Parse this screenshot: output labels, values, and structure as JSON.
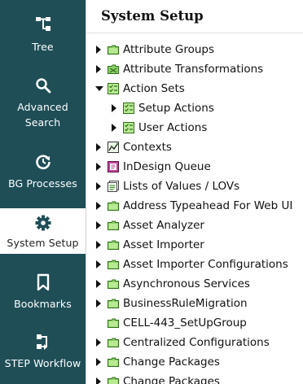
{
  "sidebar": {
    "items": [
      {
        "label": "Tree",
        "icon": "tree-icon",
        "active": false
      },
      {
        "label": "Advanced Search",
        "line1": "Advanced",
        "line2": "Search",
        "icon": "search-icon",
        "active": false
      },
      {
        "label": "BG Processes",
        "icon": "bg-processes-icon",
        "active": false
      },
      {
        "label": "System Setup",
        "icon": "gear-icon",
        "active": true
      },
      {
        "label": "Bookmarks",
        "icon": "bookmark-icon",
        "active": false
      },
      {
        "label": "STEP Workflow",
        "icon": "workflow-icon",
        "active": false
      }
    ]
  },
  "main": {
    "title": "System Setup",
    "tree": [
      {
        "label": "Attribute Groups",
        "icon": "folder-icon",
        "state": "collapsed",
        "level": 0
      },
      {
        "label": "Attribute Transformations",
        "icon": "transformation-folder-icon",
        "state": "collapsed",
        "level": 0
      },
      {
        "label": "Action Sets",
        "icon": "action-set-icon",
        "state": "expanded",
        "level": 0
      },
      {
        "label": "Setup Actions",
        "icon": "action-set-icon",
        "state": "collapsed",
        "level": 1
      },
      {
        "label": "User Actions",
        "icon": "action-set-icon",
        "state": "collapsed",
        "level": 1
      },
      {
        "label": "Contexts",
        "icon": "contexts-icon",
        "state": "collapsed",
        "level": 0
      },
      {
        "label": "InDesign Queue",
        "icon": "indesign-queue-icon",
        "state": "collapsed",
        "level": 0
      },
      {
        "label": "Lists of Values / LOVs",
        "icon": "lov-icon",
        "state": "collapsed",
        "level": 0
      },
      {
        "label": "Address Typeahead For Web UI",
        "icon": "folder-icon",
        "state": "collapsed",
        "level": 0
      },
      {
        "label": "Asset Analyzer",
        "icon": "folder-icon",
        "state": "collapsed",
        "level": 0
      },
      {
        "label": "Asset Importer",
        "icon": "folder-icon",
        "state": "collapsed",
        "level": 0
      },
      {
        "label": "Asset Importer Configurations",
        "icon": "folder-icon",
        "state": "collapsed",
        "level": 0
      },
      {
        "label": "Asynchronous Services",
        "icon": "folder-icon",
        "state": "collapsed",
        "level": 0
      },
      {
        "label": "BusinessRuleMigration",
        "icon": "folder-icon",
        "state": "collapsed",
        "level": 0
      },
      {
        "label": "CELL-443_SetUpGroup",
        "icon": "folder-icon",
        "state": "leaf",
        "level": 0
      },
      {
        "label": "Centralized Configurations",
        "icon": "folder-icon",
        "state": "collapsed",
        "level": 0
      },
      {
        "label": "Change Packages",
        "icon": "folder-icon",
        "state": "collapsed",
        "level": 0
      },
      {
        "label": "Change Packages",
        "icon": "folder-icon",
        "state": "collapsed",
        "level": 0
      }
    ]
  },
  "colors": {
    "sidebar_bg": "#1f4e57",
    "sidebar_text": "#ffffff",
    "active_bg": "#ffffff",
    "folder_green": "#8fd16a",
    "folder_border": "#2f6e1a",
    "indesign_pink": "#c0449a"
  }
}
